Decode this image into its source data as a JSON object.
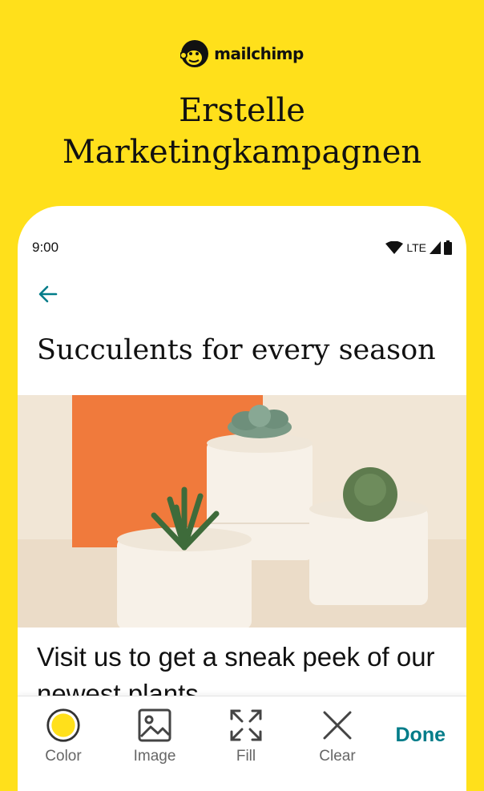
{
  "brand": {
    "logo_text": "mailchimp",
    "logo_icon": "freddie-chimp-icon"
  },
  "headline": {
    "line1": "Erstelle",
    "line2": "Marketingkampagnen"
  },
  "status_bar": {
    "time": "9:00",
    "network": "LTE"
  },
  "screen": {
    "title": "Succulents for every season",
    "body": "Visit us to get a sneak peek of our newest plants"
  },
  "toolbar": {
    "items": [
      {
        "label": "Color",
        "icon": "color-circle-icon"
      },
      {
        "label": "Image",
        "icon": "image-icon"
      },
      {
        "label": "Fill",
        "icon": "fill-expand-icon"
      },
      {
        "label": "Clear",
        "icon": "clear-x-icon"
      }
    ],
    "done_label": "Done"
  },
  "colors": {
    "background": "#FFE01B",
    "accent": "#007C89",
    "swatch": "#FFE01B"
  }
}
